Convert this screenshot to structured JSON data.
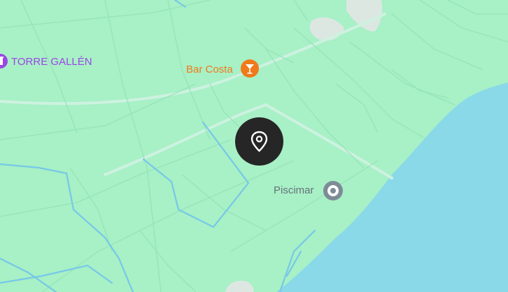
{
  "map": {
    "colors": {
      "land": "#a8f0c6",
      "water": "#8ad9e8",
      "road": "#cdf2e0",
      "minor_road": "#94e3b7",
      "stream": "#76c8e8",
      "built": "#dde7e2"
    },
    "places": {
      "torre": {
        "label": "TORRE GALLÉN",
        "icon": "tower-icon",
        "color": "#9a46e6"
      },
      "bar": {
        "label": "Bar Costa",
        "icon": "cocktail-icon",
        "color": "#f07a1a"
      },
      "piscimar": {
        "label": "Piscimar",
        "icon": "place-pin-icon",
        "color": "#7d8b96"
      }
    },
    "center_marker": {
      "icon": "location-pin-icon"
    }
  }
}
